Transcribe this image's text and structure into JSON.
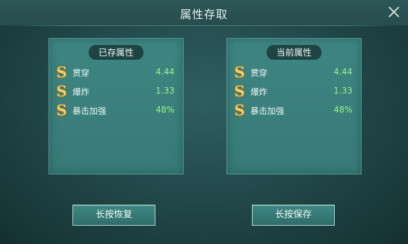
{
  "header": {
    "title": "属性存取",
    "close_icon": "close-icon"
  },
  "panels": [
    {
      "title": "已存属性",
      "stats": [
        {
          "icon": "S",
          "name": "贯穿",
          "value": "4.44"
        },
        {
          "icon": "S",
          "name": "爆炸",
          "value": "1.33"
        },
        {
          "icon": "S",
          "name": "暴击加强",
          "value": "48%"
        }
      ]
    },
    {
      "title": "当前属性",
      "stats": [
        {
          "icon": "S",
          "name": "贯穿",
          "value": "4.44"
        },
        {
          "icon": "S",
          "name": "爆炸",
          "value": "1.33"
        },
        {
          "icon": "S",
          "name": "暴击加强",
          "value": "48%"
        }
      ]
    }
  ],
  "buttons": {
    "restore_label": "长按恢复",
    "save_label": "长按保存"
  },
  "colors": {
    "value_green": "#9df08c",
    "grade_gold": "#f3cf67",
    "panel_teal": "#3e8582"
  }
}
